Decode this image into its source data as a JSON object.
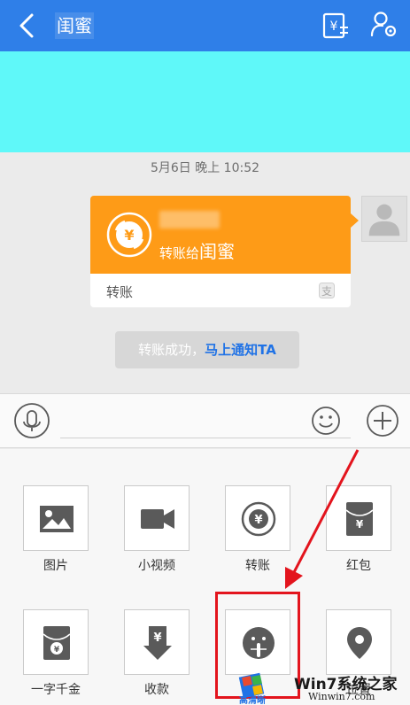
{
  "header": {
    "title": "闺蜜",
    "back_icon": "chevron-left-icon",
    "transfer_icon": "yuan-transfer-icon",
    "settings_icon": "user-settings-icon",
    "color": "#2f7fe8"
  },
  "chat": {
    "timestamp": "5月6日 晚上 10:52",
    "transfer_card": {
      "text_prefix": "转账给",
      "recipient": "闺蜜",
      "footer_label": "转账",
      "footer_icon": "alipay-icon",
      "accent_color": "#fe9b17"
    },
    "notice": {
      "text": "转账成功，",
      "link": "马上通知TA"
    }
  },
  "input_bar": {
    "mic_icon": "microphone-icon",
    "emoji_icon": "smiley-icon",
    "plus_icon": "plus-icon"
  },
  "panel": {
    "items": [
      {
        "label": "图片",
        "icon": "image-icon"
      },
      {
        "label": "小视频",
        "icon": "video-camera-icon"
      },
      {
        "label": "转账",
        "icon": "yuan-exchange-icon"
      },
      {
        "label": "红包",
        "icon": "red-envelope-icon"
      },
      {
        "label": "一字千金",
        "icon": "yuan-envelope-icon"
      },
      {
        "label": "收款",
        "icon": "yuan-download-icon"
      },
      {
        "label": "",
        "icon": "shush-face-icon"
      },
      {
        "label": "位置",
        "icon": "location-pin-icon"
      }
    ]
  },
  "watermark": {
    "line1": "Win7系统之家",
    "line2": "Winwin7.com",
    "logo_text": "高清晰"
  }
}
